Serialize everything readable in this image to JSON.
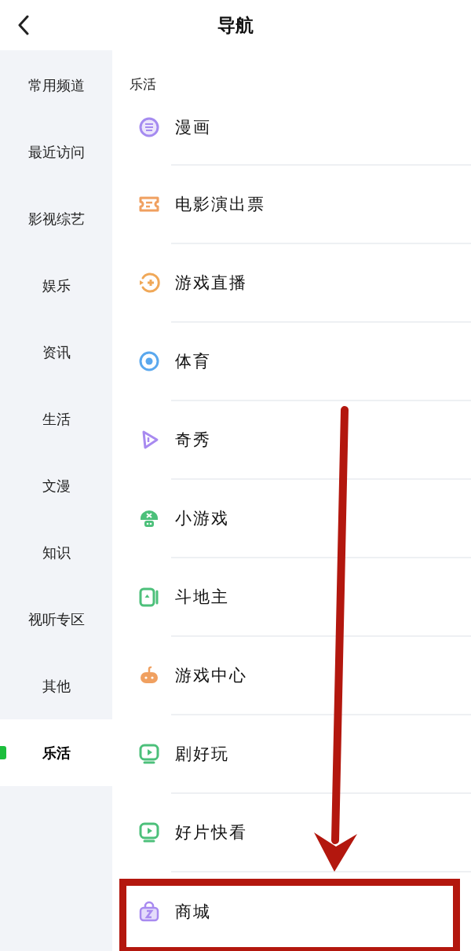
{
  "header": {
    "title": "导航"
  },
  "sidebar": {
    "items": [
      {
        "label": "常用频道",
        "selected": false
      },
      {
        "label": "最近访问",
        "selected": false
      },
      {
        "label": "影视综艺",
        "selected": false
      },
      {
        "label": "娱乐",
        "selected": false
      },
      {
        "label": "资讯",
        "selected": false
      },
      {
        "label": "生活",
        "selected": false
      },
      {
        "label": "文漫",
        "selected": false
      },
      {
        "label": "知识",
        "selected": false
      },
      {
        "label": "视听专区",
        "selected": false
      },
      {
        "label": "其他",
        "selected": false
      },
      {
        "label": "乐活",
        "selected": true
      }
    ]
  },
  "section": {
    "title": "乐活",
    "items": [
      {
        "label": "漫画"
      },
      {
        "label": "电影演出票"
      },
      {
        "label": "游戏直播"
      },
      {
        "label": "体育"
      },
      {
        "label": "奇秀"
      },
      {
        "label": "小游戏"
      },
      {
        "label": "斗地主"
      },
      {
        "label": "游戏中心"
      },
      {
        "label": "剧好玩"
      },
      {
        "label": "好片快看"
      },
      {
        "label": "商城",
        "highlighted": true
      }
    ]
  }
}
